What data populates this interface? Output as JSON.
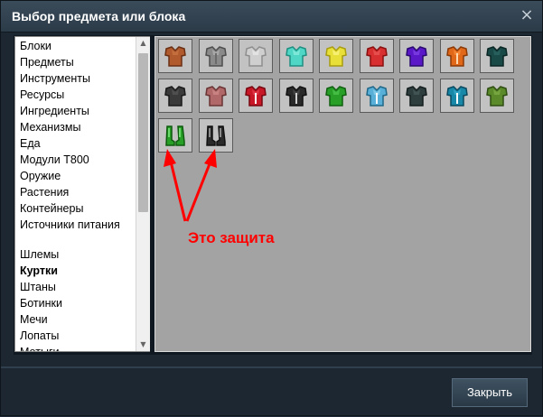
{
  "window": {
    "title": "Выбор предмета или блока",
    "close_glyph": "×"
  },
  "sidebar": {
    "items": [
      {
        "label": "Блоки",
        "selected": false
      },
      {
        "label": "Предметы",
        "selected": false
      },
      {
        "label": "Инструменты",
        "selected": false
      },
      {
        "label": "Ресурсы",
        "selected": false
      },
      {
        "label": "Ингредиенты",
        "selected": false
      },
      {
        "label": "Механизмы",
        "selected": false
      },
      {
        "label": "Еда",
        "selected": false
      },
      {
        "label": "Модули Т800",
        "selected": false
      },
      {
        "label": "Оружие",
        "selected": false
      },
      {
        "label": "Растения",
        "selected": false
      },
      {
        "label": "Контейнеры",
        "selected": false
      },
      {
        "label": "Источники питания",
        "selected": false
      },
      {
        "label": "Шлемы",
        "selected": false
      },
      {
        "label": "Куртки",
        "selected": true
      },
      {
        "label": "Штаны",
        "selected": false
      },
      {
        "label": "Ботинки",
        "selected": false
      },
      {
        "label": "Мечи",
        "selected": false
      },
      {
        "label": "Лопаты",
        "selected": false
      },
      {
        "label": "Мотыги",
        "selected": false
      }
    ]
  },
  "items": [
    {
      "icon": "jacket-icon",
      "main": "#b05a2e",
      "dark": "#6a3014",
      "light": "#d27a48",
      "accent": ""
    },
    {
      "icon": "jacket-icon",
      "main": "#8a8a8a",
      "dark": "#4e4e4e",
      "light": "#bdbdbd",
      "accent": "#6a6a6a"
    },
    {
      "icon": "jacket-icon",
      "main": "#cfcfcf",
      "dark": "#8e8e8e",
      "light": "#f0f0f0",
      "accent": ""
    },
    {
      "icon": "jacket-icon",
      "main": "#4fd6c4",
      "dark": "#1f8f82",
      "light": "#9cf2e6",
      "accent": ""
    },
    {
      "icon": "jacket-icon",
      "main": "#e8e038",
      "dark": "#a89c10",
      "light": "#fff89a",
      "accent": ""
    },
    {
      "icon": "jacket-icon",
      "main": "#d83030",
      "dark": "#8a1010",
      "light": "#f06060",
      "accent": ""
    },
    {
      "icon": "jacket-icon",
      "main": "#5a18c8",
      "dark": "#2a0a70",
      "light": "#8a4ef0",
      "accent": ""
    },
    {
      "icon": "jacket-icon",
      "main": "#e06818",
      "dark": "#8a3a08",
      "light": "#ff9a48",
      "accent": "#ffd8b0"
    },
    {
      "icon": "jacket-icon",
      "main": "#1a4a48",
      "dark": "#0a2624",
      "light": "#2e6e6a",
      "accent": ""
    },
    {
      "icon": "jacket-icon",
      "main": "#3a3a3a",
      "dark": "#1a1a1a",
      "light": "#5e5e5e",
      "accent": ""
    },
    {
      "icon": "jacket-icon",
      "main": "#b06868",
      "dark": "#6a3434",
      "light": "#d89494",
      "accent": ""
    },
    {
      "icon": "jacket-icon",
      "main": "#c81828",
      "dark": "#780810",
      "light": "#ee4a58",
      "accent": "#ffffff"
    },
    {
      "icon": "jacket-icon",
      "main": "#2a2a2a",
      "dark": "#111111",
      "light": "#555555",
      "accent": "#d0d0d0"
    },
    {
      "icon": "jacket-icon",
      "main": "#28a028",
      "dark": "#106010",
      "light": "#58d058",
      "accent": ""
    },
    {
      "icon": "jacket-icon",
      "main": "#58b0d8",
      "dark": "#206888",
      "light": "#a0dcf4",
      "accent": "#ffffff"
    },
    {
      "icon": "jacket-icon",
      "main": "#2e3e3e",
      "dark": "#141e1e",
      "light": "#506262",
      "accent": ""
    },
    {
      "icon": "jacket-icon",
      "main": "#1888a8",
      "dark": "#0a4a60",
      "light": "#48b8d8",
      "accent": "#ffffff"
    },
    {
      "icon": "jacket-icon",
      "main": "#5a8a2a",
      "dark": "#2e4e12",
      "light": "#88b850",
      "accent": ""
    },
    {
      "icon": "boots-icon",
      "main": "#28a028",
      "dark": "#0e5a0e",
      "light": "#6ad86a",
      "accent": ""
    },
    {
      "icon": "boots-icon",
      "main": "#2a2a2a",
      "dark": "#111111",
      "light": "#8a8a8a",
      "accent": ""
    }
  ],
  "annotation": {
    "text": "Это защита",
    "color": "#ff0000"
  },
  "footer": {
    "close_label": "Закрыть"
  }
}
